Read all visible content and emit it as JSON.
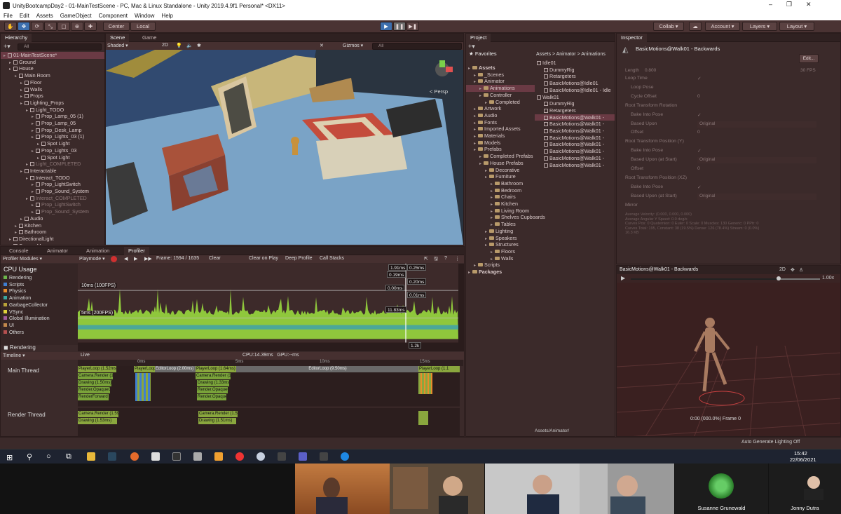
{
  "window": {
    "title": "UnityBootcampDay2 - 01-MainTestScene - PC, Mac & Linux Standalone - Unity 2019.4.9f1 Personal* <DX11>",
    "controls": [
      "–",
      "❐",
      "✕"
    ]
  },
  "menu": [
    "File",
    "Edit",
    "Assets",
    "GameObject",
    "Component",
    "Window",
    "Help"
  ],
  "toolbar": {
    "pivot": "Center",
    "space": "Local",
    "collab": "Collab",
    "account": "Account",
    "layers": "Layers",
    "layout": "Layout"
  },
  "hierarchy": {
    "tab": "Hierarchy",
    "search": "All",
    "rows": [
      {
        "label": "01-MainTestScene*",
        "depth": 0,
        "icon": "scene",
        "sel": true
      },
      {
        "label": "Ground",
        "depth": 1
      },
      {
        "label": "House",
        "depth": 1
      },
      {
        "label": "Main Room",
        "depth": 2
      },
      {
        "label": "Floor",
        "depth": 3
      },
      {
        "label": "Walls",
        "depth": 3
      },
      {
        "label": "Props",
        "depth": 3
      },
      {
        "label": "Lighting_Props",
        "depth": 3
      },
      {
        "label": "Light_TODO",
        "depth": 4
      },
      {
        "label": "Prop_Lamp_05 (1)",
        "depth": 5
      },
      {
        "label": "Prop_Lamp_05",
        "depth": 5
      },
      {
        "label": "Prop_Desk_Lamp",
        "depth": 5
      },
      {
        "label": "Prop_Lights_03 (1)",
        "depth": 5
      },
      {
        "label": "Spot Light",
        "depth": 6
      },
      {
        "label": "Prop_Lights_03",
        "depth": 5
      },
      {
        "label": "Spot Light",
        "depth": 6
      },
      {
        "label": "Light_COMPLETED",
        "depth": 4,
        "dim": true
      },
      {
        "label": "Interactable",
        "depth": 3
      },
      {
        "label": "Interact_TODO",
        "depth": 4
      },
      {
        "label": "Prop_LightSwitch",
        "depth": 5
      },
      {
        "label": "Prop_Sound_System",
        "depth": 5
      },
      {
        "label": "Interact_COMPLETED",
        "depth": 4,
        "dim": true
      },
      {
        "label": "Prop_LightSwitch",
        "depth": 5,
        "dim": true
      },
      {
        "label": "Prop_Sound_System",
        "depth": 5,
        "dim": true
      },
      {
        "label": "Audio",
        "depth": 3
      },
      {
        "label": "Kitchen",
        "depth": 2
      },
      {
        "label": "Bathroom",
        "depth": 2
      },
      {
        "label": "DirectionalLight",
        "depth": 1
      },
      {
        "label": "CameraManager",
        "depth": 1
      }
    ]
  },
  "scene": {
    "tabs": [
      "Scene",
      "Game"
    ],
    "shading": "Shaded",
    "mode2d": "2D",
    "gizmos": "Gizmos",
    "search": "All",
    "persp": "< Persp"
  },
  "profiler": {
    "tabs": [
      "Console",
      "Animator",
      "Animation",
      "Profiler"
    ],
    "modules_label": "Profiler Modules",
    "playmode": "Playmode",
    "frame": "Frame: 1594 / 1635",
    "clear": "Clear",
    "clear_on_play": "Clear on Play",
    "deep_profile": "Deep Profile",
    "call_stacks": "Call Stacks",
    "cpu_title": "CPU Usage",
    "categories": [
      {
        "name": "Rendering",
        "color": "#6cb64b"
      },
      {
        "name": "Scripts",
        "color": "#3f7fd1"
      },
      {
        "name": "Physics",
        "color": "#e88d2b"
      },
      {
        "name": "Animation",
        "color": "#3aa7a0"
      },
      {
        "name": "GarbageCollector",
        "color": "#b8a238"
      },
      {
        "name": "VSync",
        "color": "#e0d23a"
      },
      {
        "name": "Global Illumination",
        "color": "#a05b9e"
      },
      {
        "name": "UI",
        "color": "#c2884c"
      },
      {
        "name": "Others",
        "color": "#b54f4f"
      }
    ],
    "line_10ms": "10ms (100FPS)",
    "line_5ms": "5ms (200FPS)",
    "vals": [
      "1.91ms",
      "0.25ms",
      "0.19ms",
      "0.20ms",
      "0.00ms",
      "0.01ms",
      "11.83ms",
      "1.2k"
    ],
    "rendering_title": "Rendering",
    "timeline_label": "Timeline",
    "live_label": "Live",
    "cpu_gpu": "CPU:14.39ms   GPU:--ms",
    "ruler": [
      "0ms",
      "5ms",
      "10ms",
      "15ms"
    ],
    "main_thread": "Main Thread",
    "render_thread": "Render Thread",
    "tracks": {
      "a1": "PlayerLoop (1.52ms)",
      "a2": "PlayerLoop (1.0)",
      "a3": "EditorLoop (2.00ms)",
      "a4": "PlayerLoop (1.64ms)",
      "a5": "EditorLoop (9.50ms)",
      "a6": "PlayerLoop (1.1",
      "b1": "Camera.Render (1.1",
      "b2": "Drawing (1.50ms)",
      "b3": "Render.OpaqueGeometry",
      "b4": "RenderForward",
      "b5": "Camera.Render (1.5",
      "b6": "Drawing (1.33ms)",
      "b7": "Render.OpaqueGeometry",
      "b8": "Render.Opaque.R",
      "c1": "Camera.Render (1.59",
      "c2": "Drawing (1.53ms)",
      "c3": "Camera.Render (1.50",
      "c4": "Drawing (1.51ms)"
    }
  },
  "project": {
    "tab": "Project",
    "breadcrumb": [
      "Assets",
      "Animator",
      "Animations"
    ],
    "favorites": "Favorites",
    "tree": [
      {
        "label": "Assets",
        "depth": 0,
        "bold": true
      },
      {
        "label": "_Scenes",
        "depth": 1
      },
      {
        "label": "Animator",
        "depth": 1
      },
      {
        "label": "Animations",
        "depth": 2,
        "sel": true
      },
      {
        "label": "Controller",
        "depth": 2
      },
      {
        "label": "Completed",
        "depth": 3
      },
      {
        "label": "Artwork",
        "depth": 1
      },
      {
        "label": "Audio",
        "depth": 1
      },
      {
        "label": "Fonts",
        "depth": 1
      },
      {
        "label": "Imported Assets",
        "depth": 1
      },
      {
        "label": "Materials",
        "depth": 1
      },
      {
        "label": "Models",
        "depth": 1
      },
      {
        "label": "Prefabs",
        "depth": 1
      },
      {
        "label": "Completed Prefabs",
        "depth": 2
      },
      {
        "label": "House Prefabs",
        "depth": 2
      },
      {
        "label": "Decorative",
        "depth": 3
      },
      {
        "label": "Furniture",
        "depth": 3
      },
      {
        "label": "Bathroom",
        "depth": 4
      },
      {
        "label": "Bedroom",
        "depth": 4
      },
      {
        "label": "Chairs",
        "depth": 4
      },
      {
        "label": "Kitchen",
        "depth": 4
      },
      {
        "label": "Living Room",
        "depth": 4
      },
      {
        "label": "Shelves Cupboards",
        "depth": 4
      },
      {
        "label": "Tables",
        "depth": 4
      },
      {
        "label": "Lighting",
        "depth": 3
      },
      {
        "label": "Speakers",
        "depth": 3
      },
      {
        "label": "Structures",
        "depth": 3
      },
      {
        "label": "Floors",
        "depth": 4
      },
      {
        "label": "Walls",
        "depth": 4
      },
      {
        "label": "Scripts",
        "depth": 1
      },
      {
        "label": "Packages",
        "depth": 0,
        "bold": true
      }
    ],
    "files": [
      {
        "label": "Idle01",
        "depth": 0
      },
      {
        "label": "DummyRig",
        "depth": 1
      },
      {
        "label": "Retargeters",
        "depth": 1
      },
      {
        "label": "BasicMotions@Idle01",
        "depth": 1
      },
      {
        "label": "BasicMotions@Idle01 - Idle",
        "depth": 1
      },
      {
        "label": "Walk01",
        "depth": 0
      },
      {
        "label": "DummyRig",
        "depth": 1
      },
      {
        "label": "Retargeters",
        "depth": 1
      },
      {
        "label": "BasicMotions@Walk01 -",
        "depth": 1,
        "sel": true
      },
      {
        "label": "BasicMotions@Walk01 -",
        "depth": 1
      },
      {
        "label": "BasicMotions@Walk01 -",
        "depth": 1
      },
      {
        "label": "BasicMotions@Walk01 -",
        "depth": 1
      },
      {
        "label": "BasicMotions@Walk01 -",
        "depth": 1
      },
      {
        "label": "BasicMotions@Walk01 -",
        "depth": 1
      },
      {
        "label": "BasicMotions@Walk01 -",
        "depth": 1
      },
      {
        "label": "BasicMotions@Walk01 -",
        "depth": 1
      }
    ],
    "footer_path": "Assets/Animator/"
  },
  "inspector": {
    "tab": "Inspector",
    "title": "BasicMotions@Walk01 - Backwards",
    "edit": "Edit...",
    "length_label": "Length",
    "length_val": "0.800",
    "fps": "30 FPS",
    "fields": [
      {
        "label": "Loop Time",
        "value": "✓",
        "indent": 0
      },
      {
        "label": "Loop Pose",
        "value": "",
        "indent": 1
      },
      {
        "label": "Cycle Offset",
        "value": "0",
        "indent": 1
      },
      {
        "label": "Root Transform Rotation",
        "value": "",
        "indent": 0
      },
      {
        "label": "Bake Into Pose",
        "value": "✓",
        "indent": 1
      },
      {
        "label": "Based Upon",
        "value": "Original",
        "indent": 1,
        "drop": true
      },
      {
        "label": "Offset",
        "value": "0",
        "indent": 1
      },
      {
        "label": "Root Transform Position (Y)",
        "value": "",
        "indent": 0
      },
      {
        "label": "Bake Into Pose",
        "value": "✓",
        "indent": 1
      },
      {
        "label": "Based Upon (at Start)",
        "value": "Original",
        "indent": 1,
        "drop": true
      },
      {
        "label": "Offset",
        "value": "0",
        "indent": 1
      },
      {
        "label": "Root Transform Position (XZ)",
        "value": "",
        "indent": 0
      },
      {
        "label": "Bake Into Pose",
        "value": "✓",
        "indent": 1
      },
      {
        "label": "Based Upon (at Start)",
        "value": "Original",
        "indent": 1,
        "drop": true
      },
      {
        "label": "Mirror",
        "value": "",
        "indent": 0
      }
    ],
    "stats": [
      "Average Velocity: (0.000, 0.000, 0.000)",
      "Average Angular Y Speed: 0.0 deg/s",
      "Curves Pos: 0 Quaternion: 0 Euler: 0 Scale: 0 Muscles: 130 Generic: 0 PPtr: 0",
      "Curves Total: 195, Constant: 38 (19.5%) Dense: 126 (78.4%) Stream: 0 (0.0%)",
      "16.3 KB"
    ],
    "preview_title": "BasicMotions@Walk01 - Backwards",
    "preview_speed": "1.00x",
    "preview_frame": "0:00 (000.0%) Frame 0",
    "preview_2d": "2D"
  },
  "status": {
    "right": "Auto Generate Lighting Off"
  },
  "taskbar": {
    "time": "15:42",
    "date": "22/06/2021"
  },
  "video": {
    "names": [
      "Susanne Grunewald",
      "Jonny Dutra"
    ]
  },
  "colors": {
    "accent": "#3d6fae",
    "selection": "#6a3a44",
    "panel": "#3b2a2a",
    "cpu_green": "#8fc73c"
  }
}
